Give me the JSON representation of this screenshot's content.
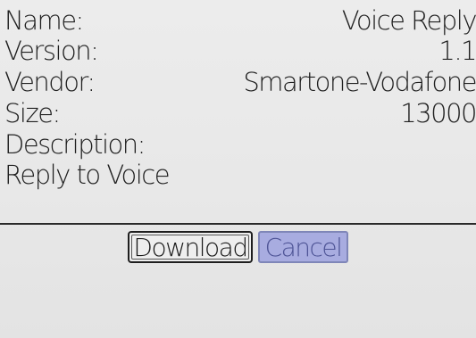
{
  "details": {
    "name_label": "Name:",
    "name_value": "Voice Reply",
    "version_label": "Version:",
    "version_value": "1.1",
    "vendor_label": "Vendor:",
    "vendor_value": "Smartone-Vodafone",
    "size_label": "Size:",
    "size_value": "13000",
    "description_label": "Description:",
    "description_value": "Reply to Voice"
  },
  "actions": {
    "download_label": "Download",
    "cancel_label": "Cancel"
  },
  "colors": {
    "background": "#e6e7e7",
    "text": "#202020",
    "cancel_fill": "#a8ace0",
    "cancel_text": "#4e5496"
  }
}
